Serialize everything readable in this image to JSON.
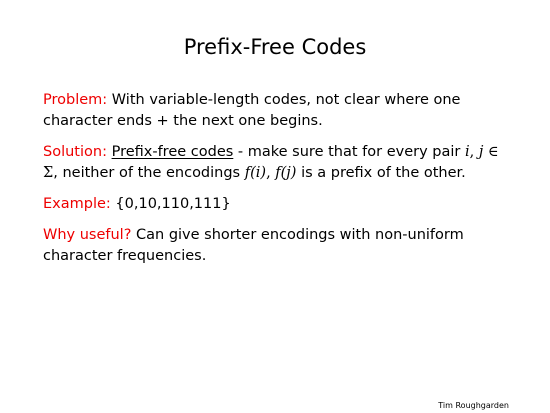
{
  "title": "Prefix-Free Codes",
  "problem": {
    "label": "Problem:",
    "text": "With variable-length codes, not clear where one character ends + the next one begins."
  },
  "solution": {
    "label": "Solution:",
    "term": "Prefix-free codes",
    "text_a": " - make sure that for every pair ",
    "math_i": "i",
    "comma1": ", ",
    "math_j": "j",
    "in_sigma": " ∈ Σ",
    "text_b": ", neither of the encodings ",
    "math_fi": "f(i)",
    "comma2": ", ",
    "math_fj": "f(j)",
    "text_c": " is a prefix of the other."
  },
  "example": {
    "label": "Example:",
    "text": "{0,10,110,111}"
  },
  "why": {
    "label": "Why useful?",
    "text": "Can give shorter encodings with non-uniform character frequencies."
  },
  "footer": "Tim Roughgarden"
}
